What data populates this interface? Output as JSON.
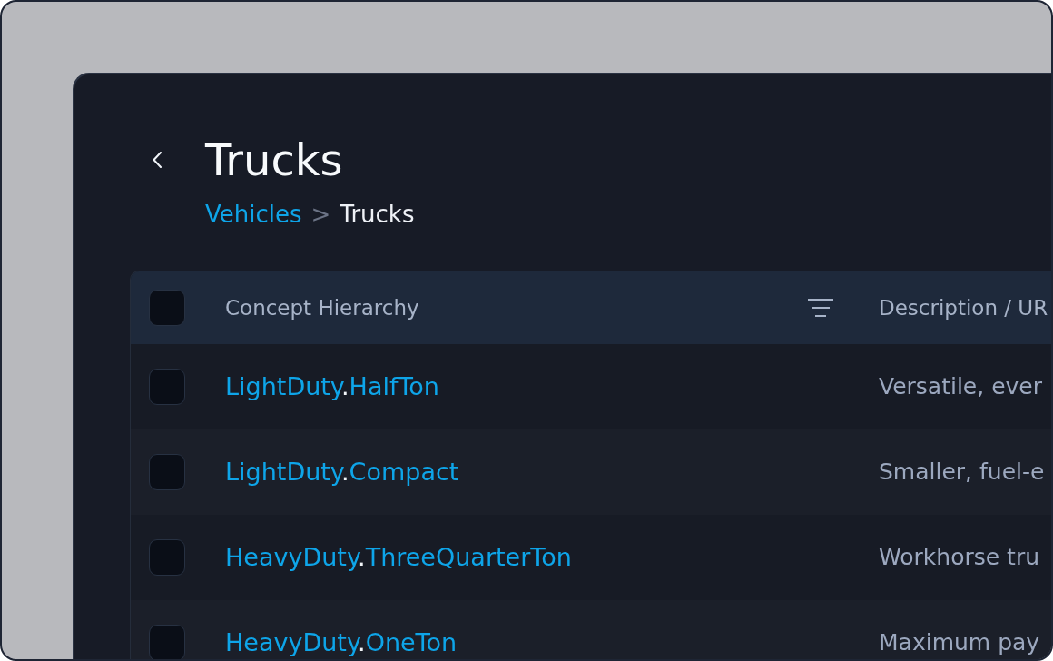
{
  "page": {
    "title": "Trucks",
    "breadcrumb": [
      {
        "label": "Vehicles",
        "kind": "link"
      },
      {
        "label": ">",
        "kind": "separator"
      },
      {
        "label": "Trucks",
        "kind": "current"
      }
    ]
  },
  "table": {
    "select_all": {
      "checked": false
    },
    "columns": [
      {
        "label": "Concept Hierarchy",
        "filter": true
      },
      {
        "label": "Description / UR"
      }
    ],
    "rows": [
      {
        "checked": false,
        "concept": {
          "parent": "LightDuty",
          "separator": ".",
          "child": "HalfTon"
        },
        "description": "Versatile, ever"
      },
      {
        "checked": false,
        "concept": {
          "parent": "LightDuty",
          "separator": ".",
          "child": "Compact"
        },
        "description": "Smaller, fuel-e"
      },
      {
        "checked": false,
        "concept": {
          "parent": "HeavyDuty",
          "separator": ".",
          "child": "ThreeQuarterTon"
        },
        "description": "Workhorse tru"
      },
      {
        "checked": false,
        "concept": {
          "parent": "HeavyDuty",
          "separator": ".",
          "child": "OneTon"
        },
        "description": "Maximum pay"
      }
    ]
  }
}
